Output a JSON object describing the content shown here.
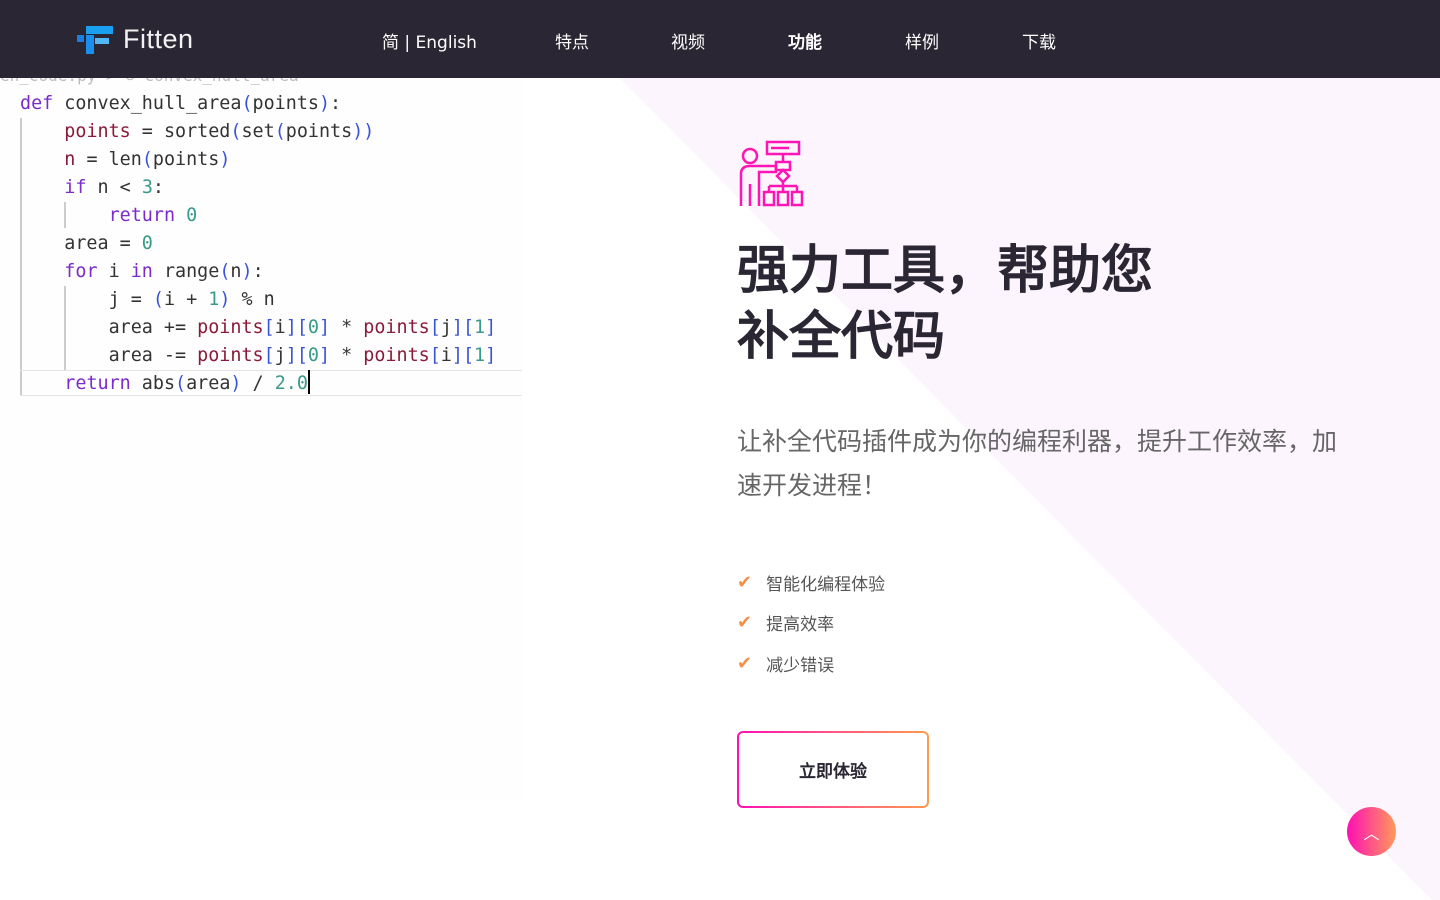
{
  "nav": {
    "brand": "Fitten",
    "items": [
      "简 | English",
      "特点",
      "视频",
      "功能",
      "样例",
      "下载"
    ]
  },
  "code": {
    "breadcrumb": "en_code.py  >  ⊙ convex_hull_area"
  },
  "hero": {
    "title_line1": "强力工具，帮助您",
    "title_line2": "补全代码",
    "subtitle": "让补全代码插件成为你的编程利器，提升工作效率，加速开发进程！",
    "features": [
      "智能化编程体验",
      "提高效率",
      "减少错误"
    ],
    "cta": "立即体验",
    "icon": "presenter-flowchart-icon"
  },
  "colors": {
    "nav_bg": "#2a2633",
    "accent_start": "#ff0fb4",
    "accent_end": "#ff9a50",
    "check": "#f5904a"
  }
}
